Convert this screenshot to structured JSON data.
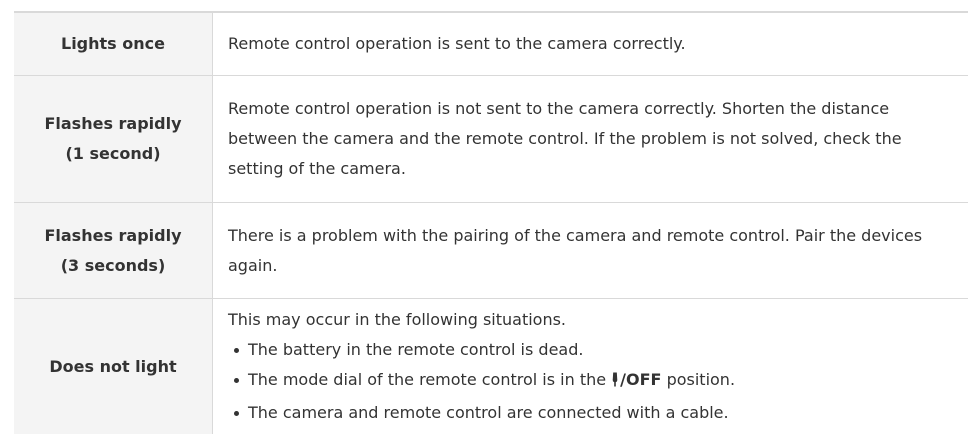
{
  "rows": [
    {
      "label": "Lights once",
      "description": "Remote control operation is sent to the camera correctly."
    },
    {
      "label": "Flashes rapidly",
      "label_sub": "(1 second)",
      "description": "Remote control operation is not sent to the camera correctly. Shorten the distance between the camera and the remote control. If the problem is not solved, check the setting of the camera."
    },
    {
      "label": "Flashes rapidly",
      "label_sub": "(3 seconds)",
      "description": "There is a problem with the pairing of the camera and remote control. Pair the devices again."
    },
    {
      "label": "Does not light",
      "intro": "This may occur in the following situations.",
      "bullets": [
        "The battery in the remote control is dead.",
        {
          "before": "The mode dial of the remote control is in the ",
          "icon": "power-icon",
          "bold": "/OFF",
          "after": " position."
        },
        "The camera and remote control are connected with a cable."
      ]
    }
  ]
}
